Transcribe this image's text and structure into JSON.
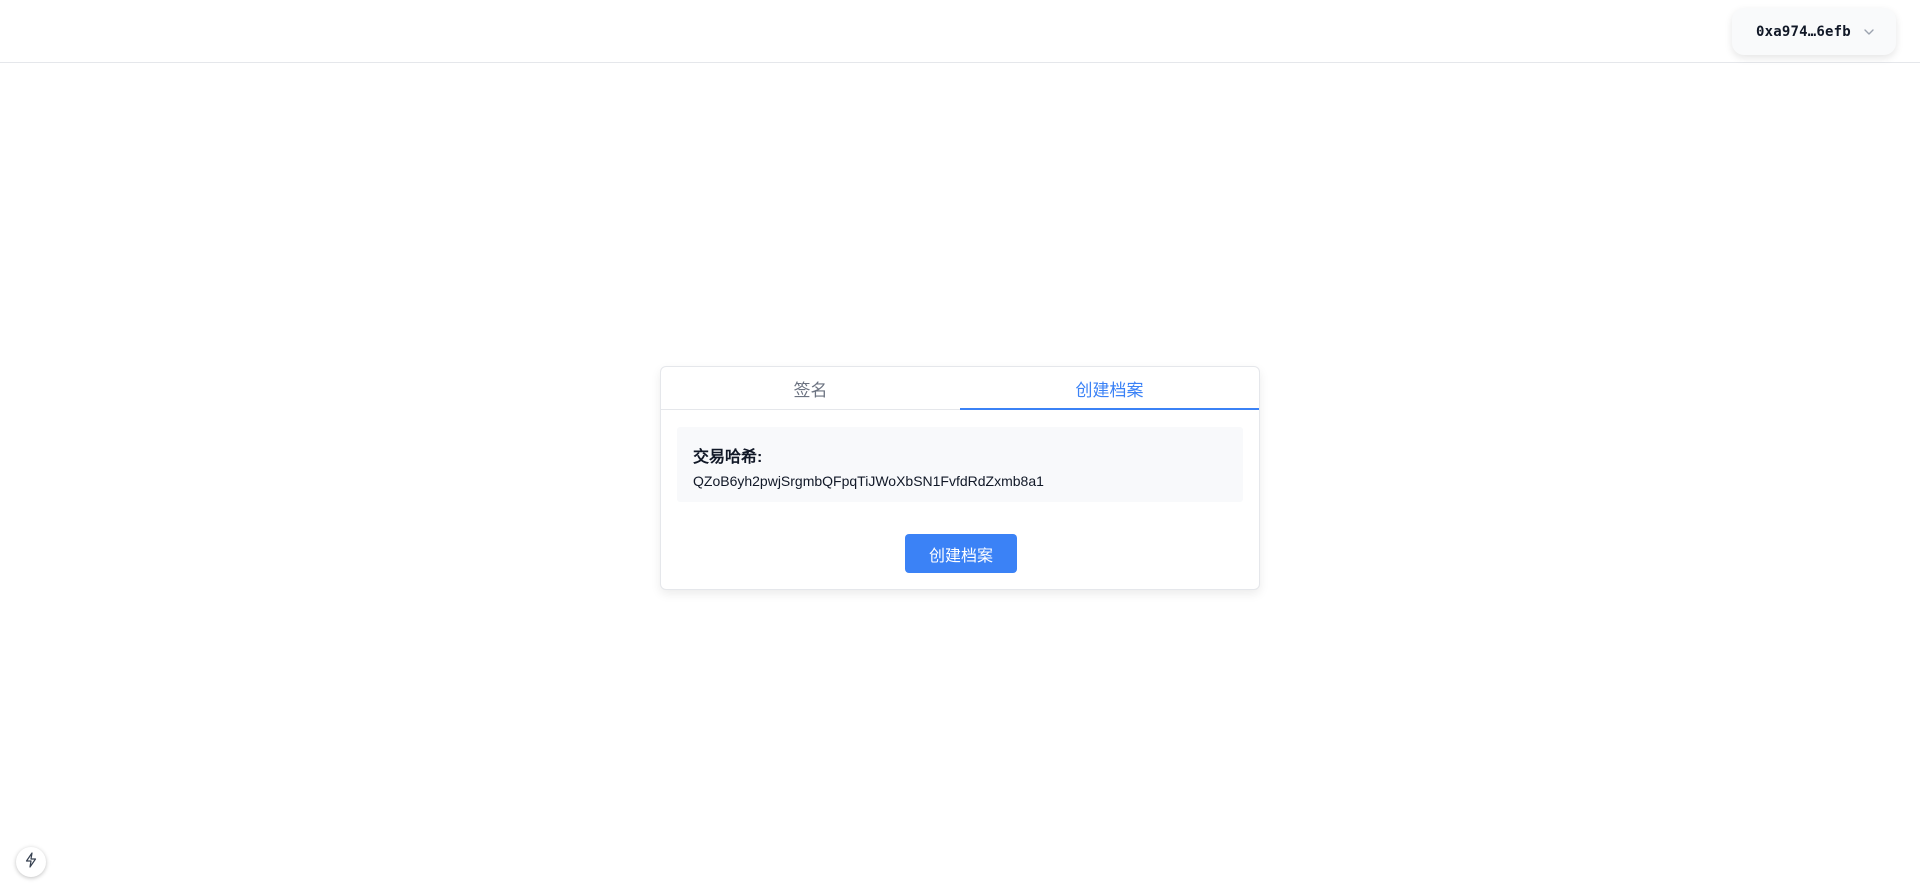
{
  "header": {
    "wallet_address": "0xa974…6efb",
    "wallet_dropdown_icon": "chevron-down-icon"
  },
  "card": {
    "tabs": [
      {
        "label": "签名",
        "active": false
      },
      {
        "label": "创建档案",
        "active": true
      }
    ],
    "hash_label": "交易哈希:",
    "hash_value": "QZoB6yh2pwjSrgmbQFpqTiJWoXbSN1FvfdRdZxmb8a1",
    "create_button_label": "创建档案"
  },
  "dev_badge": {
    "icon": "lightning-icon"
  },
  "colors": {
    "accent": "#3b82f6",
    "border": "#e5e7eb",
    "hash_box_bg": "#f8f9fb"
  }
}
